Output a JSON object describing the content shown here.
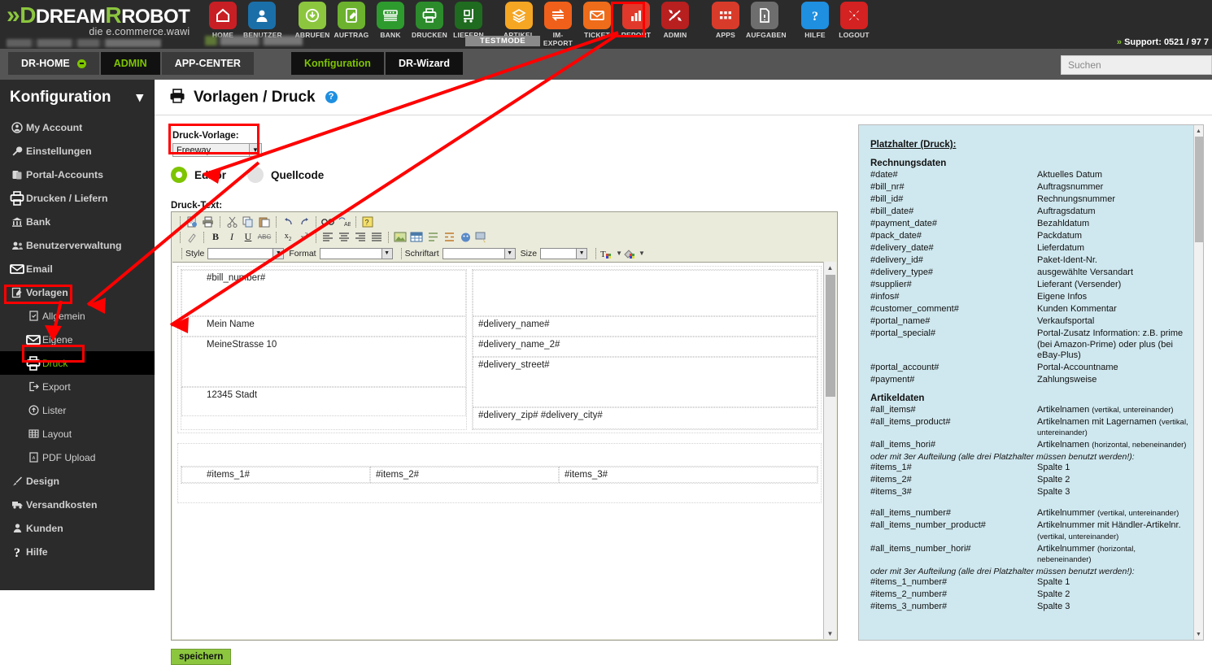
{
  "brand": {
    "name_part1": "DREAM",
    "name_part2": "ROBOT",
    "tagline": "die e.commerce.wawi",
    "chevron": "»"
  },
  "topbar": {
    "testmode_label": "TESTMODE",
    "support_text": "Support: 0521 / 97 7",
    "support_chevron": "»",
    "icons": [
      {
        "label": "HOME",
        "icon": "home-icon",
        "color": "#c81f25"
      },
      {
        "label": "BENUTZER",
        "icon": "user-icon",
        "color": "#1b6fa8"
      },
      {
        "label": "ABRUFEN",
        "icon": "download-cloud-icon",
        "color": "#8cc63f"
      },
      {
        "label": "AUFTRAG",
        "icon": "order-edit-icon",
        "color": "#6cb22e"
      },
      {
        "label": "BANK",
        "icon": "bank-cash-icon",
        "color": "#2e9b2e"
      },
      {
        "label": "DRUCKEN",
        "icon": "printer-icon",
        "color": "#2c8c2c"
      },
      {
        "label": "LIEFERN",
        "icon": "delivery-cart-icon",
        "color": "#1f6b1f"
      },
      {
        "label": "ARTIKEL",
        "icon": "package-icon",
        "color": "#f5a623"
      },
      {
        "label": "IM-EXPORT",
        "icon": "import-export-icon",
        "color": "#f0601a"
      },
      {
        "label": "TICKET",
        "icon": "envelope-icon",
        "color": "#ef6c1a"
      },
      {
        "label": "REPORT",
        "icon": "bar-chart-icon",
        "color": "#e0392b"
      },
      {
        "label": "ADMIN",
        "icon": "tools-icon",
        "color": "#b81f1f"
      },
      {
        "label": "APPS",
        "icon": "grid-apps-icon",
        "color": "#d93b2b"
      },
      {
        "label": "AUFGABEN",
        "icon": "document-icon",
        "color": "#6e6e6e"
      },
      {
        "label": "HILFE",
        "icon": "question-icon",
        "color": "#1f8fe0"
      },
      {
        "label": "LOGOUT",
        "icon": "logout-x-icon",
        "color": "#d42121"
      }
    ]
  },
  "navbar": {
    "items": [
      {
        "label": "DR-HOME",
        "state": "default",
        "has_dot": true
      },
      {
        "label": "ADMIN",
        "state": "active-green",
        "has_dot": false
      },
      {
        "label": "APP-CENTER",
        "state": "default",
        "has_dot": false
      }
    ],
    "subitems": [
      {
        "label": "Konfiguration",
        "state": "active-green"
      },
      {
        "label": "DR-Wizard",
        "state": "default"
      }
    ],
    "search_placeholder": "Suchen"
  },
  "sidebar": {
    "title": "Konfiguration",
    "items": [
      {
        "label": "My Account",
        "icon": "account-icon",
        "level": 0,
        "selected": false
      },
      {
        "label": "Einstellungen",
        "icon": "wrench-icon",
        "level": 0,
        "selected": false
      },
      {
        "label": "Portal-Accounts",
        "icon": "portal-icon",
        "level": 0,
        "selected": false
      },
      {
        "label": "Drucken / Liefern",
        "icon": "printer-icon",
        "level": 0,
        "selected": false
      },
      {
        "label": "Bank",
        "icon": "bank-icon",
        "level": 0,
        "selected": false
      },
      {
        "label": "Benutzerverwaltung",
        "icon": "users-icon",
        "level": 0,
        "selected": false
      },
      {
        "label": "Email",
        "icon": "envelope-icon",
        "level": 0,
        "selected": false
      },
      {
        "label": "Vorlagen",
        "icon": "templates-icon",
        "level": 0,
        "selected": false
      },
      {
        "label": "Allgemein",
        "icon": "doc-icon",
        "level": 1,
        "selected": false
      },
      {
        "label": "Eigene",
        "icon": "envelope-icon",
        "level": 1,
        "selected": false
      },
      {
        "label": "Druck",
        "icon": "printer-icon",
        "level": 1,
        "selected": true
      },
      {
        "label": "Export",
        "icon": "export-icon",
        "level": 1,
        "selected": false
      },
      {
        "label": "Lister",
        "icon": "cloud-upload-icon",
        "level": 1,
        "selected": false
      },
      {
        "label": "Layout",
        "icon": "table-grid-icon",
        "level": 1,
        "selected": false
      },
      {
        "label": "PDF Upload",
        "icon": "pdf-icon",
        "level": 1,
        "selected": false
      },
      {
        "label": "Design",
        "icon": "brush-icon",
        "level": 0,
        "selected": false
      },
      {
        "label": "Versandkosten",
        "icon": "truck-icon",
        "level": 0,
        "selected": false
      },
      {
        "label": "Kunden",
        "icon": "person-icon",
        "level": 0,
        "selected": false
      },
      {
        "label": "Hilfe",
        "icon": "question-icon",
        "level": 0,
        "selected": false
      }
    ]
  },
  "page": {
    "title": "Vorlagen / Druck",
    "help_glyph": "?",
    "template_label": "Druck-Vorlage:",
    "template_value": "Freeway",
    "radio_editor": "Editor",
    "radio_source": "Quellcode",
    "drucktext_label": "Druck-Text:",
    "save_label": "speichern"
  },
  "editor": {
    "combo_style_label": "Style",
    "combo_format_label": "Format",
    "combo_font_label": "Schriftart",
    "combo_size_label": "Size",
    "combo_style_value": "",
    "combo_format_value": "",
    "combo_font_value": "",
    "combo_size_value": "",
    "doc": {
      "bill_number": "#bill_number#",
      "sender_name": "Mein Name",
      "sender_street": "MeineStrasse 10",
      "sender_city": "12345 Stadt",
      "delivery_name": "#delivery_name#",
      "delivery_name_2": "#delivery_name_2#",
      "delivery_street": "#delivery_street#",
      "delivery_zip_city": "#delivery_zip# #delivery_city#",
      "items_1": "#items_1#",
      "items_2": "#items_2#",
      "items_3": "#items_3#"
    }
  },
  "placeholders": {
    "heading": "Platzhalter (Druck):",
    "section_1_title": "Rechnungsdaten",
    "section_1": [
      {
        "key": "#date#",
        "value": "Aktuelles Datum"
      },
      {
        "key": "#bill_nr#",
        "value": "Auftragsnummer"
      },
      {
        "key": "#bill_id#",
        "value": "Rechnungsnummer"
      },
      {
        "key": "#bill_date#",
        "value": "Auftragsdatum"
      },
      {
        "key": "#payment_date#",
        "value": "Bezahldatum"
      },
      {
        "key": "#pack_date#",
        "value": "Packdatum"
      },
      {
        "key": "#delivery_date#",
        "value": "Lieferdatum"
      },
      {
        "key": "#delivery_id#",
        "value": "Paket-Ident-Nr."
      },
      {
        "key": "#delivery_type#",
        "value": "ausgewählte Versandart"
      },
      {
        "key": "#supplier#",
        "value": "Lieferant (Versender)"
      },
      {
        "key": "#infos#",
        "value": "Eigene Infos"
      },
      {
        "key": "#customer_comment#",
        "value": "Kunden Kommentar"
      },
      {
        "key": "#portal_name#",
        "value": "Verkaufsportal"
      },
      {
        "key": "#portal_special#",
        "value": "Portal-Zusatz Information: z.B. prime (bei Amazon-Prime) oder plus (bei eBay-Plus)"
      },
      {
        "key": "#portal_account#",
        "value": "Portal-Accountname"
      },
      {
        "key": "#payment#",
        "value": "Zahlungsweise"
      }
    ],
    "section_2_title": "Artikeldaten",
    "section_2a": [
      {
        "key": "#all_items#",
        "value": "Artikelnamen",
        "small": "(vertikal, untereinander)"
      },
      {
        "key": "#all_items_product#",
        "value": "Artikelnamen mit Lagernamen",
        "small": "(vertikal, untereinander)"
      },
      {
        "key": "#all_items_hori#",
        "value": "Artikelnamen",
        "small": "(horizontal, nebeneinander)"
      }
    ],
    "note": "oder mit 3er Aufteilung (alle drei Platzhalter müssen benutzt werden!):",
    "section_2b": [
      {
        "key": "#items_1#",
        "value": "Spalte 1"
      },
      {
        "key": "#items_2#",
        "value": "Spalte 2"
      },
      {
        "key": "#items_3#",
        "value": "Spalte 3"
      }
    ],
    "section_2c": [
      {
        "key": "#all_items_number#",
        "value": "Artikelnummer",
        "small": "(vertikal, untereinander)"
      },
      {
        "key": "#all_items_number_product#",
        "value": "Artikelnummer mit Händler-Artikelnr.",
        "small": "(vertikal, untereinander)"
      },
      {
        "key": "#all_items_number_hori#",
        "value": "Artikelnummer",
        "small": "(horizontal, nebeneinander)"
      }
    ],
    "section_2d": [
      {
        "key": "#items_1_number#",
        "value": "Spalte 1"
      },
      {
        "key": "#items_2_number#",
        "value": "Spalte 2"
      },
      {
        "key": "#items_3_number#",
        "value": "Spalte 3"
      }
    ]
  },
  "annotations": {
    "color": "#ff0000",
    "boxes": [
      "admin-toolbar-icon",
      "druck-vorlage-select",
      "vorlagen-sidebar-item",
      "druck-sidebar-item"
    ]
  }
}
